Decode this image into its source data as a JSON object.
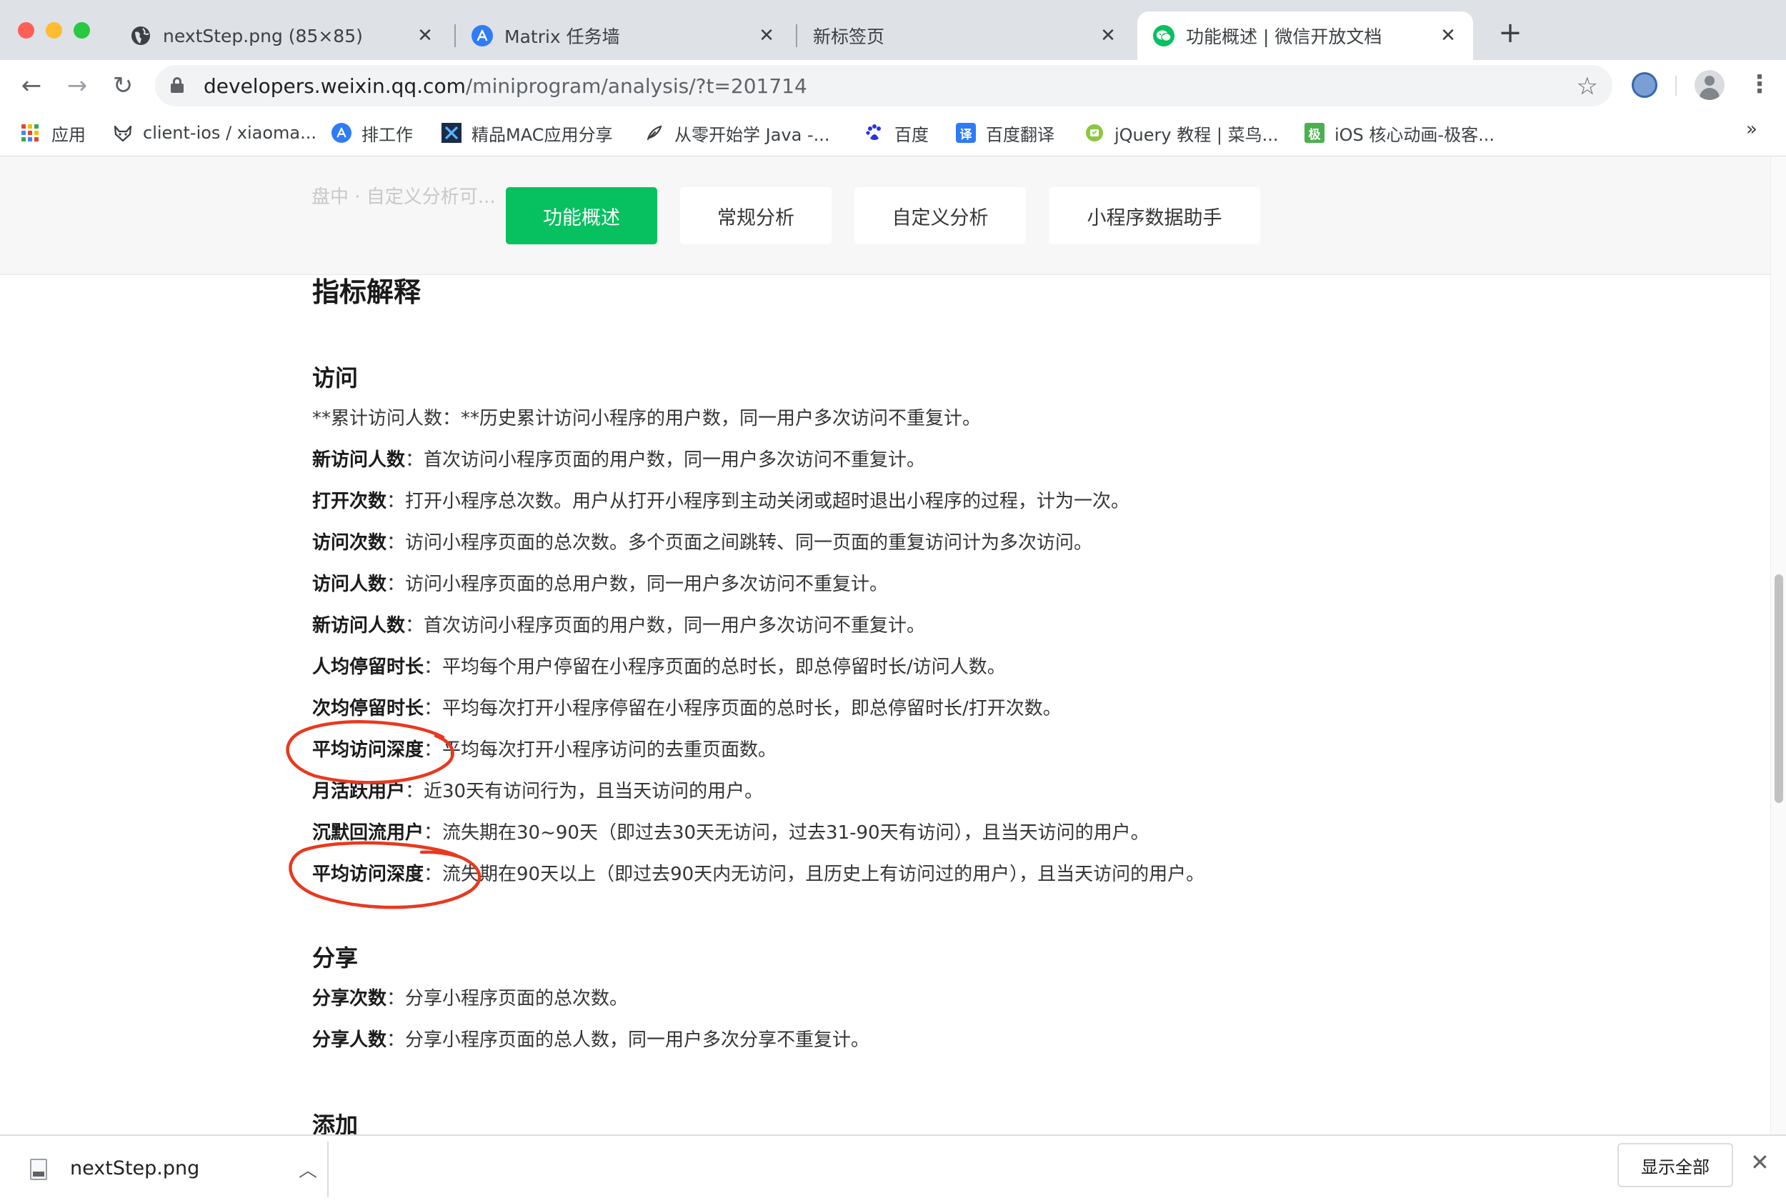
{
  "tabs": [
    {
      "title": "nextStep.png (85×85)",
      "favicon": "globe-icon",
      "active": false
    },
    {
      "title": "Matrix 任务墙",
      "favicon": "app-a-icon",
      "active": false
    },
    {
      "title": "新标签页",
      "favicon": "",
      "active": false
    },
    {
      "title": "功能概述 | 微信开放文档",
      "favicon": "wechat-icon",
      "active": true
    }
  ],
  "toolbar": {
    "url_host": "developers.weixin.qq.com",
    "url_path": "/miniprogram/analysis/?t=201714"
  },
  "bookmarks": [
    {
      "label": "应用",
      "icon": "apps-grid-icon"
    },
    {
      "label": "client-ios / xiaoma...",
      "icon": "gitlab-fox-icon"
    },
    {
      "label": "排工作",
      "icon": "app-a-icon"
    },
    {
      "label": "精品MAC应用分享",
      "icon": "x-logo-icon"
    },
    {
      "label": "从零开始学 Java -...",
      "icon": "feather-icon"
    },
    {
      "label": "百度",
      "icon": "baidu-paw-icon"
    },
    {
      "label": "百度翻译",
      "icon": "translate-icon",
      "glyph": "译"
    },
    {
      "label": "jQuery 教程 | 菜鸟...",
      "icon": "runoob-icon"
    },
    {
      "label": "iOS 核心动画-极客...",
      "icon": "jike-icon",
      "glyph": "极"
    }
  ],
  "page": {
    "ghost_text": "盘中 · 自定义分析可...",
    "nav_tabs": [
      {
        "label": "功能概述",
        "active": true
      },
      {
        "label": "常规分析",
        "active": false
      },
      {
        "label": "自定义分析",
        "active": false
      },
      {
        "label": "小程序数据助手",
        "active": false
      }
    ],
    "heading": "指标解释",
    "sections": {
      "visit": {
        "title": "访问",
        "items": [
          {
            "term": "",
            "desc": "**累计访问人数：**历史累计访问小程序的用户数，同一用户多次访问不重复计。"
          },
          {
            "term": "新访问人数",
            "desc": "：首次访问小程序页面的用户数，同一用户多次访问不重复计。"
          },
          {
            "term": "打开次数",
            "desc": "：打开小程序总次数。用户从打开小程序到主动关闭或超时退出小程序的过程，计为一次。"
          },
          {
            "term": "访问次数",
            "desc": "：访问小程序页面的总次数。多个页面之间跳转、同一页面的重复访问计为多次访问。"
          },
          {
            "term": "访问人数",
            "desc": "：访问小程序页面的总用户数，同一用户多次访问不重复计。"
          },
          {
            "term": "新访问人数",
            "desc": "：首次访问小程序页面的用户数，同一用户多次访问不重复计。"
          },
          {
            "term": "人均停留时长",
            "desc": "：平均每个用户停留在小程序页面的总时长，即总停留时长/访问人数。"
          },
          {
            "term": "次均停留时长",
            "desc": "：平均每次打开小程序停留在小程序页面的总时长，即总停留时长/打开次数。"
          },
          {
            "term": "平均访问深度",
            "desc": "：平均每次打开小程序访问的去重页面数。"
          },
          {
            "term": "月活跃用户",
            "desc": "：近30天有访问行为，且当天访问的用户。"
          },
          {
            "term": "沉默回流用户",
            "desc": "：流失期在30~90天（即过去30天无访问，过去31-90天有访问），且当天访问的用户。"
          },
          {
            "term": "平均访问深度",
            "desc": "：流失期在90天以上（即过去90天内无访问，且历史上有访问过的用户），且当天访问的用户。"
          }
        ]
      },
      "share": {
        "title": "分享",
        "items": [
          {
            "term": "分享次数",
            "desc": "：分享小程序页面的总次数。"
          },
          {
            "term": "分享人数",
            "desc": "：分享小程序页面的总人数，同一用户多次分享不重复计。"
          }
        ]
      },
      "add": {
        "title": "添加"
      }
    }
  },
  "downloads": {
    "file_name": "nextStep.png",
    "show_all_label": "显示全部"
  },
  "colors": {
    "wechat_green": "#07c160",
    "annotation_red": "#e8391f",
    "tab_strip": "#dee1e6"
  }
}
